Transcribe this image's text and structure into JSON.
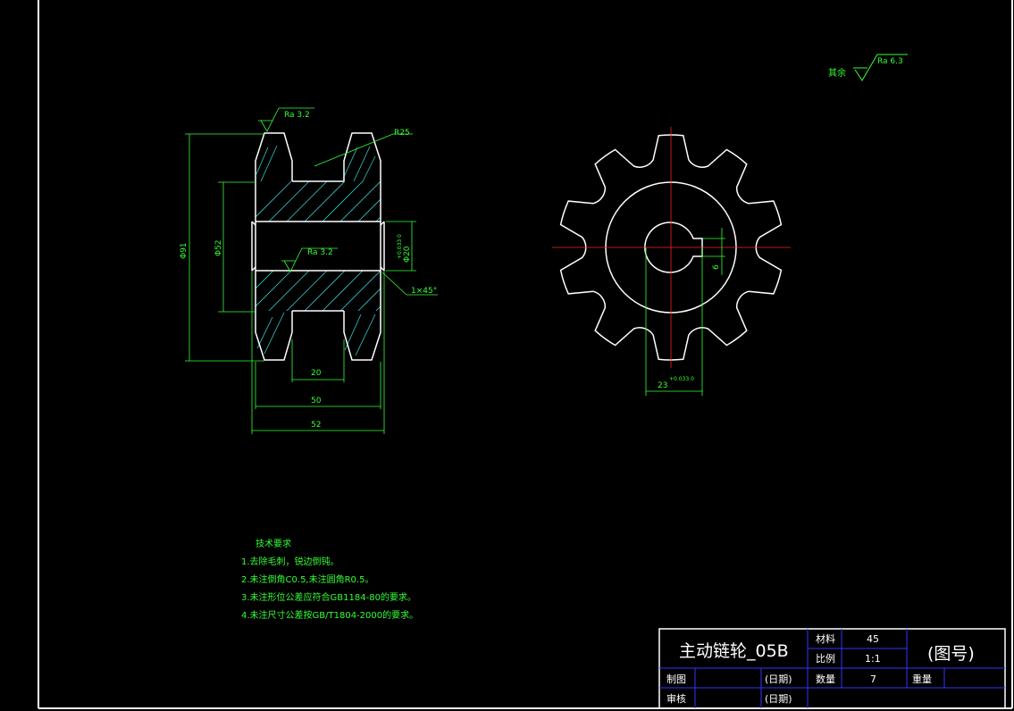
{
  "drawing": {
    "colors": {
      "background": "#000000",
      "frame": "#ffffff",
      "outline": "#ffffff",
      "dimension": "#33ff33",
      "hatch": "#33cccc",
      "centerline": "#ff2020",
      "title_text": "#ffffff",
      "table_lines": "#3333ff"
    },
    "roughness": {
      "general_prefix": "其余",
      "general_value": "Ra 6.3",
      "tooth_face": "Ra 3.2",
      "bore": "Ra 3.2"
    },
    "side_view_dims": {
      "outer_dia": "Φ91",
      "hub_dia": "Φ52",
      "radius": "R25",
      "bore_dia": "Φ20",
      "bore_tol": "+0.033  0",
      "chamfer": "1×45°",
      "groove_width": "20",
      "mid_width": "50",
      "total_width": "52"
    },
    "front_view_dims": {
      "key_depth": "23",
      "key_depth_tol": "+0.033  0",
      "key_width": "6"
    },
    "front_view": {
      "teeth": 10
    },
    "tech_requirements": {
      "title": "技术要求",
      "items": [
        "1.去除毛刺，锐边倒钝。",
        "2.未注倒角C0.5,未注圆角R0.5。",
        "3.未注形位公差应符合GB1184-80的要求。",
        "4.未注尺寸公差按GB/T1804-2000的要求。"
      ]
    },
    "title_block": {
      "part_name": "主动链轮_05B",
      "material_label": "材料",
      "material": "45",
      "scale_label": "比例",
      "scale": "1:1",
      "qty_label": "数量",
      "qty": "7",
      "weight_label": "重量",
      "drawn_label": "制图",
      "checked_label": "审核",
      "date_label": "(日期)",
      "drawing_no": "(图号)"
    }
  }
}
